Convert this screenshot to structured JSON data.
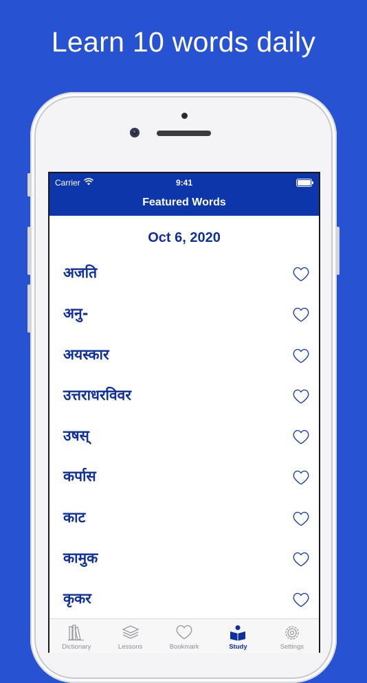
{
  "headline": "Learn 10 words daily",
  "status_bar": {
    "carrier": "Carrier",
    "time": "9:41"
  },
  "navbar": {
    "title": "Featured Words"
  },
  "date": "Oct 6, 2020",
  "words": [
    "अजति",
    "अनु-",
    "अयस्कार",
    "उत्तराधरविवर",
    "उषस्",
    "कर्पास",
    "काट",
    "कामुक",
    "कृकर"
  ],
  "tabs": [
    {
      "label": "Dictionary",
      "icon": "books-icon",
      "active": false
    },
    {
      "label": "Lessons",
      "icon": "stack-icon",
      "active": false
    },
    {
      "label": "Bookmark",
      "icon": "heart-icon",
      "active": false
    },
    {
      "label": "Study",
      "icon": "reader-icon",
      "active": true
    },
    {
      "label": "Settings",
      "icon": "gear-icon",
      "active": false
    }
  ],
  "colors": {
    "background": "#2753d3",
    "navbar": "#0d36aa",
    "accent": "#0e2f9d",
    "tab_inactive": "#8e8e93"
  }
}
